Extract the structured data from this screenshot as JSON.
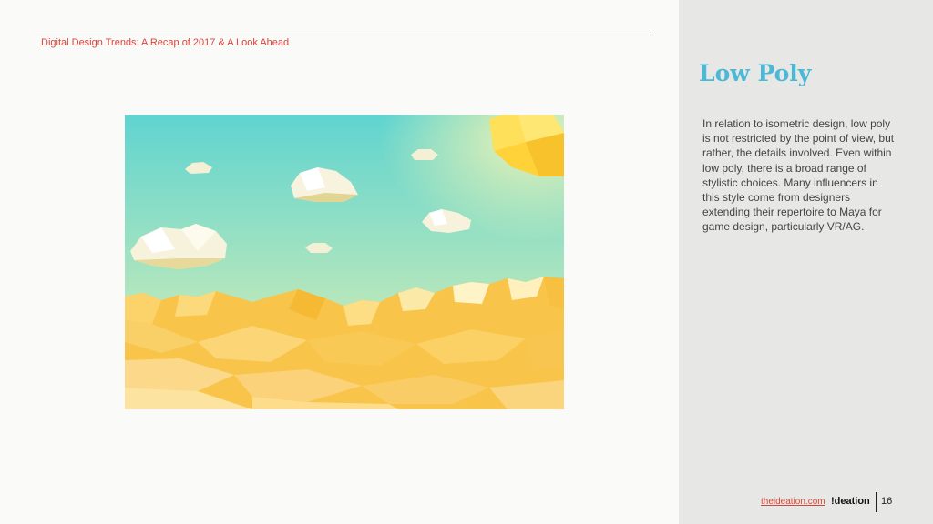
{
  "header": {
    "text": "Digital Design Trends: A Recap of 2017 & A Look Ahead"
  },
  "slide": {
    "title": "Low Poly",
    "body": "In relation to isometric design, low poly is not restricted by the point of view, but rather, the details involved. Even within low poly, there is a broad range of stylistic choices. Many influencers in this style come from designers extending their repertoire to Maya for game design, particularly VR/AG."
  },
  "illustration": {
    "subject": "low-poly-landscape",
    "colors": {
      "sky_top": "#5fd4d0",
      "sky_bottom": "#e9efb4",
      "sun": "#ffd23a",
      "mountain": "#f8c44a",
      "cloud": "#f6f2dc"
    }
  },
  "footer": {
    "link": "theideation.com",
    "logo": "!deation",
    "page": "16"
  },
  "colors": {
    "accent_red": "#d9443a",
    "title_blue": "#4bb8d6",
    "panel": "#e7e8e5"
  }
}
